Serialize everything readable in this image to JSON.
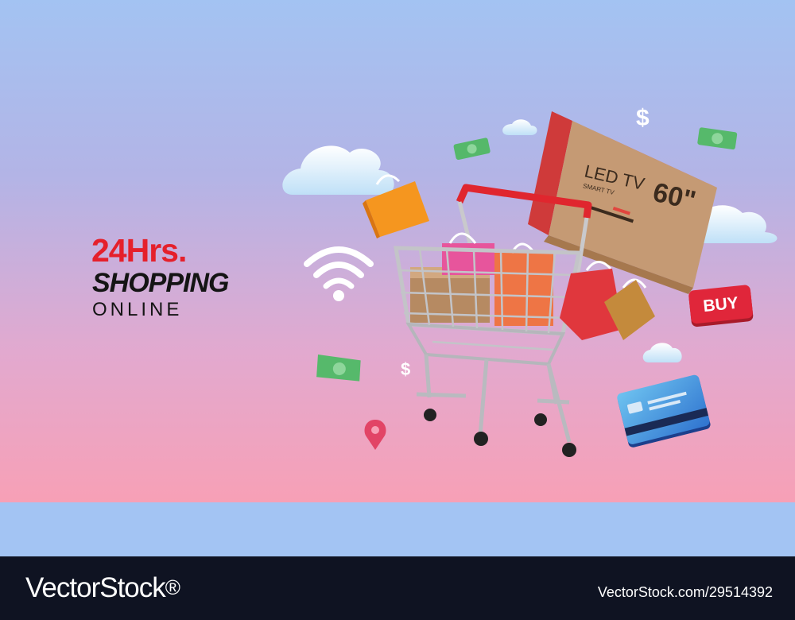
{
  "headline": {
    "line1": "24Hrs.",
    "line2": "SHOPPING",
    "line3": "ONLINE"
  },
  "tv_box": {
    "brand_text": "LED TV",
    "size_text": "60\"",
    "subtitle": "SMART TV"
  },
  "buy_badge": {
    "label": "BUY"
  },
  "currency_symbols": [
    "$",
    "$"
  ],
  "icons": [
    "wifi-icon",
    "location-pin-icon",
    "shopping-cart-icon",
    "credit-card-icon",
    "dollar-bill-icon",
    "shopping-bag-icon",
    "cloud-icon"
  ],
  "footer": {
    "brand": "VectorStock",
    "url": "VectorStock.com/29514392"
  },
  "colors": {
    "sky_top": "#a3c3f2",
    "sky_bottom": "#f7a0b6",
    "headline_red": "#e5202b",
    "footer_bg": "#0f1322",
    "buy_red": "#e0263a"
  }
}
